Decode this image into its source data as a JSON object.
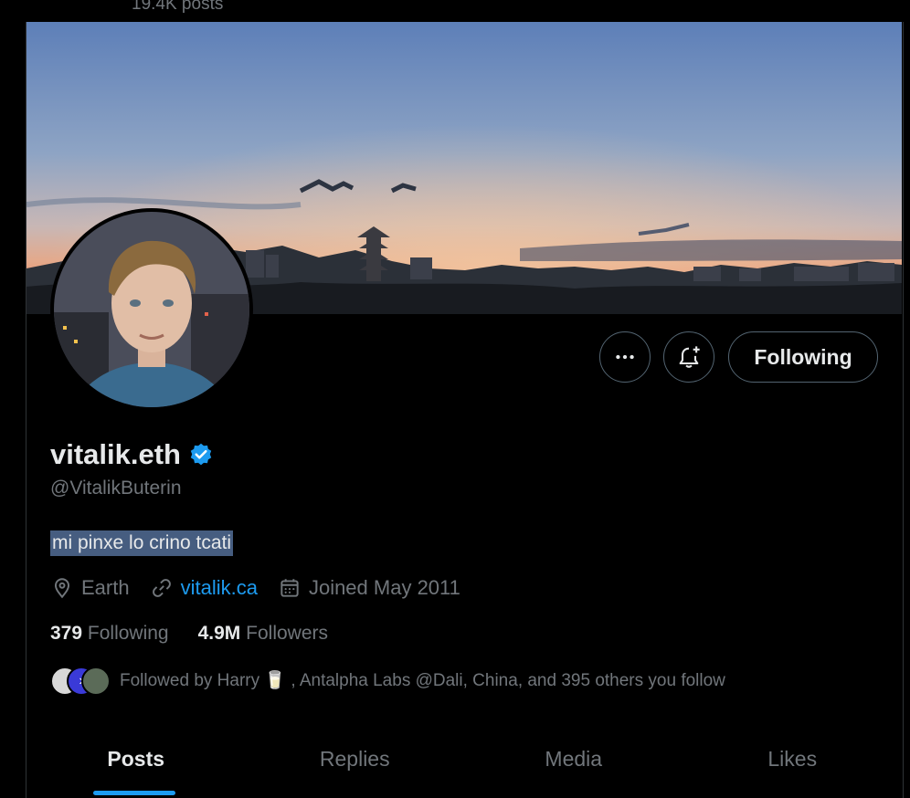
{
  "header": {
    "post_count": "19.4K posts"
  },
  "profile": {
    "display_name": "vitalik.eth",
    "handle": "@VitalikButerin",
    "bio": "mi pinxe lo crino tcati",
    "location": "Earth",
    "website": "vitalik.ca",
    "joined": "Joined May 2011",
    "following_count": "379",
    "following_label": "Following",
    "followers_count": "4.9M",
    "followers_label": "Followers",
    "followed_by": "Followed by Harry 🥛 , Antalpha Labs @Dali, China, and 395 others you follow"
  },
  "actions": {
    "more_icon": "more-icon",
    "notify_icon": "bell-plus-icon",
    "follow_state": "Following"
  },
  "tabs": [
    {
      "label": "Posts",
      "active": true
    },
    {
      "label": "Replies",
      "active": false
    },
    {
      "label": "Media",
      "active": false
    },
    {
      "label": "Likes",
      "active": false
    }
  ],
  "colors": {
    "accent": "#1d9bf0",
    "background": "#000000",
    "muted": "#71767b",
    "text": "#e7e9ea"
  }
}
